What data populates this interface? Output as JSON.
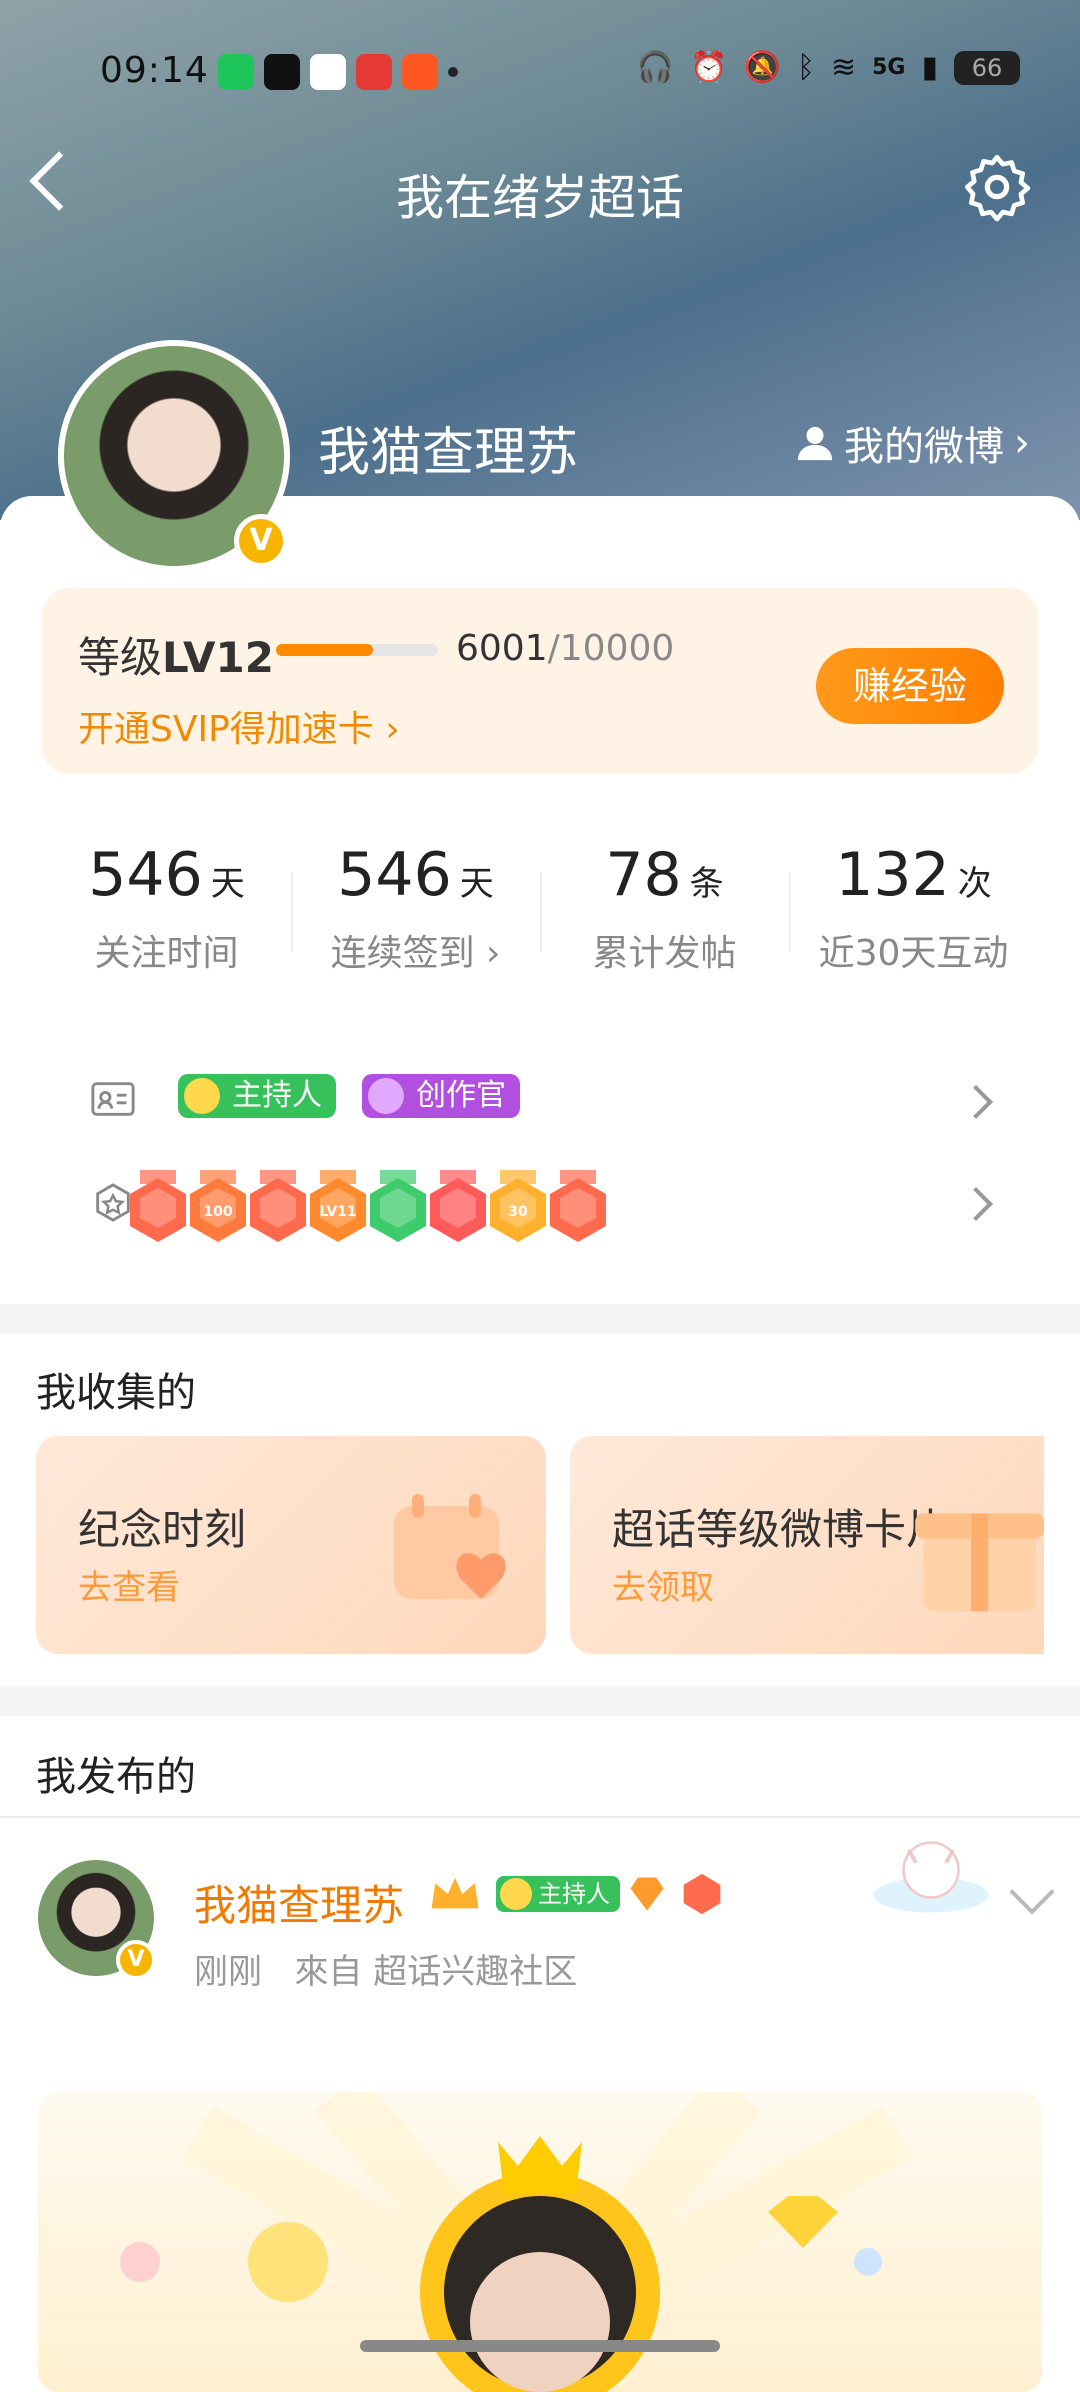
{
  "status_bar": {
    "time": "09:14",
    "battery": "66",
    "network": "5G"
  },
  "header": {
    "title": "我在绪岁超话"
  },
  "profile": {
    "name": "我猫查理苏",
    "my_weibo": "我的微博"
  },
  "level": {
    "label": "等级",
    "level": "LV12",
    "progress_current": "6001",
    "progress_max": "/10000",
    "progress_fraction": 0.6001,
    "svip_text": "开通SVIP得加速卡",
    "earn_button": "赚经验"
  },
  "stats": [
    {
      "num": "546",
      "unit": "天",
      "label": "关注时间"
    },
    {
      "num": "546",
      "unit": "天",
      "label": "连续签到"
    },
    {
      "num": "78",
      "unit": "条",
      "label": "累计发帖"
    },
    {
      "num": "132",
      "unit": "次",
      "label": "近30天互动"
    }
  ],
  "badges": {
    "tags": [
      {
        "label": "主持人",
        "color": "#37c15b"
      },
      {
        "label": "创作官",
        "color": "#b04fe0"
      }
    ],
    "medal_colors": [
      "#ff6a4d",
      "#ff7a3d",
      "#ff6a4d",
      "#ff8a2d",
      "#3ecb6b",
      "#ff5a5a",
      "#ffb02d",
      "#ff6a4d"
    ],
    "medal_texts": [
      "",
      "100",
      "",
      "LV11",
      "",
      "",
      "30",
      ""
    ]
  },
  "collection": {
    "title": "我收集的",
    "items": [
      {
        "title": "纪念时刻",
        "sub": "去查看"
      },
      {
        "title": "超话等级微博卡片",
        "sub": "去领取"
      }
    ]
  },
  "published": {
    "title": "我发布的",
    "post": {
      "name": "我猫查理苏",
      "tag": "主持人",
      "time": "刚刚",
      "source": "來自 超话兴趣社区"
    }
  },
  "colors": {
    "accent": "#ff8a00",
    "brand_orange": "#f07a00"
  }
}
